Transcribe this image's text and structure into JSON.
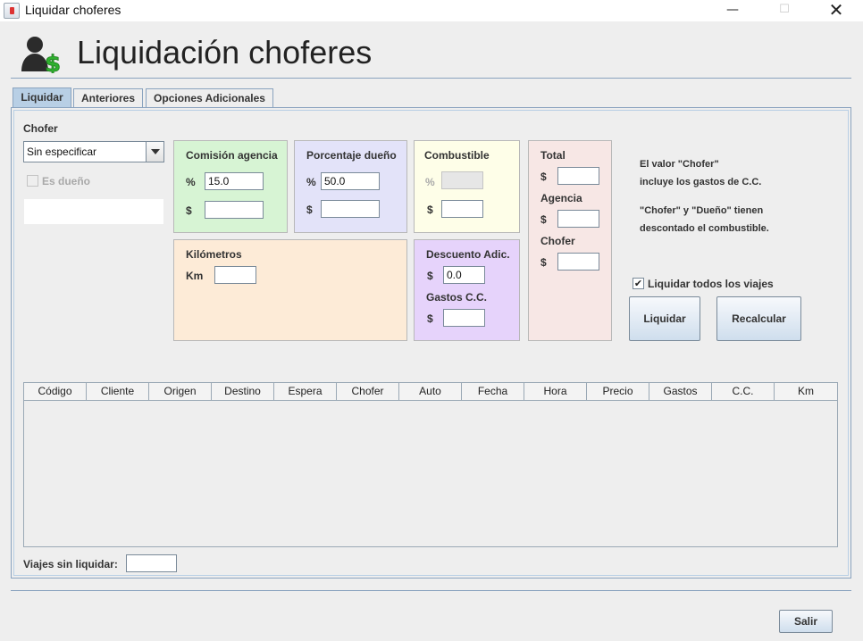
{
  "window": {
    "title": "Liquidar choferes",
    "min": "—",
    "max": "☐",
    "close": "✕"
  },
  "header": {
    "title": "Liquidación choferes",
    "icon": "driver-money-icon"
  },
  "tabs": [
    {
      "label": "Liquidar",
      "active": true
    },
    {
      "label": "Anteriores",
      "active": false
    },
    {
      "label": "Opciones Adicionales",
      "active": false
    }
  ],
  "chofer": {
    "label": "Chofer",
    "selected": "Sin especificar",
    "es_dueno_label": "Es dueño",
    "es_dueno_checked": false,
    "extra_value": ""
  },
  "comision": {
    "title": "Comisión agencia",
    "pct_label": "%",
    "pct_value": "15.0",
    "money_label": "$",
    "money_value": ""
  },
  "porcentaje": {
    "title": "Porcentaje dueño",
    "pct_label": "%",
    "pct_value": "50.0",
    "money_label": "$",
    "money_value": ""
  },
  "combustible": {
    "title": "Combustible",
    "pct_label": "%",
    "pct_value": "",
    "money_label": "$",
    "money_value": ""
  },
  "kilometros": {
    "title": "Kilómetros",
    "km_label": "Km",
    "km_value": ""
  },
  "descuento": {
    "title": "Descuento Adic.",
    "money_label": "$",
    "money_value": "0.0",
    "gastos_title": "Gastos C.C.",
    "gastos_money_label": "$",
    "gastos_value": ""
  },
  "totales": {
    "total_label": "Total",
    "total_money": "$",
    "total_value": "",
    "agencia_label": "Agencia",
    "agencia_money": "$",
    "agencia_value": "",
    "chofer_label": "Chofer",
    "chofer_money": "$",
    "chofer_value": ""
  },
  "info": {
    "line1": "El valor \"Chofer\"",
    "line2": "incluye los gastos de C.C.",
    "line3": "\"Chofer\" y \"Dueño\" tienen",
    "line4": "descontado el combustible."
  },
  "liquidar_todos": {
    "label": "Liquidar todos los viajes",
    "checked": true,
    "mark": "✔"
  },
  "buttons": {
    "liquidar": "Liquidar",
    "recalcular": "Recalcular",
    "salir": "Salir"
  },
  "table": {
    "columns": [
      "Código",
      "Cliente",
      "Origen",
      "Destino",
      "Espera",
      "Chofer",
      "Auto",
      "Fecha",
      "Hora",
      "Precio",
      "Gastos",
      "C.C.",
      "Km"
    ],
    "rows": []
  },
  "viajes_sin_liquidar": {
    "label": "Viajes sin liquidar:",
    "value": ""
  },
  "colors": {
    "tab_active": "#b8cfe5",
    "border_blue": "#8aa3bf",
    "green_box": "#d7f4d4",
    "lavender_box": "#e3e3f9",
    "cream_box": "#fefee8",
    "peach_box": "#fdebd7",
    "purple_box": "#e6d3fb",
    "pink_box": "#f7e7e5"
  }
}
